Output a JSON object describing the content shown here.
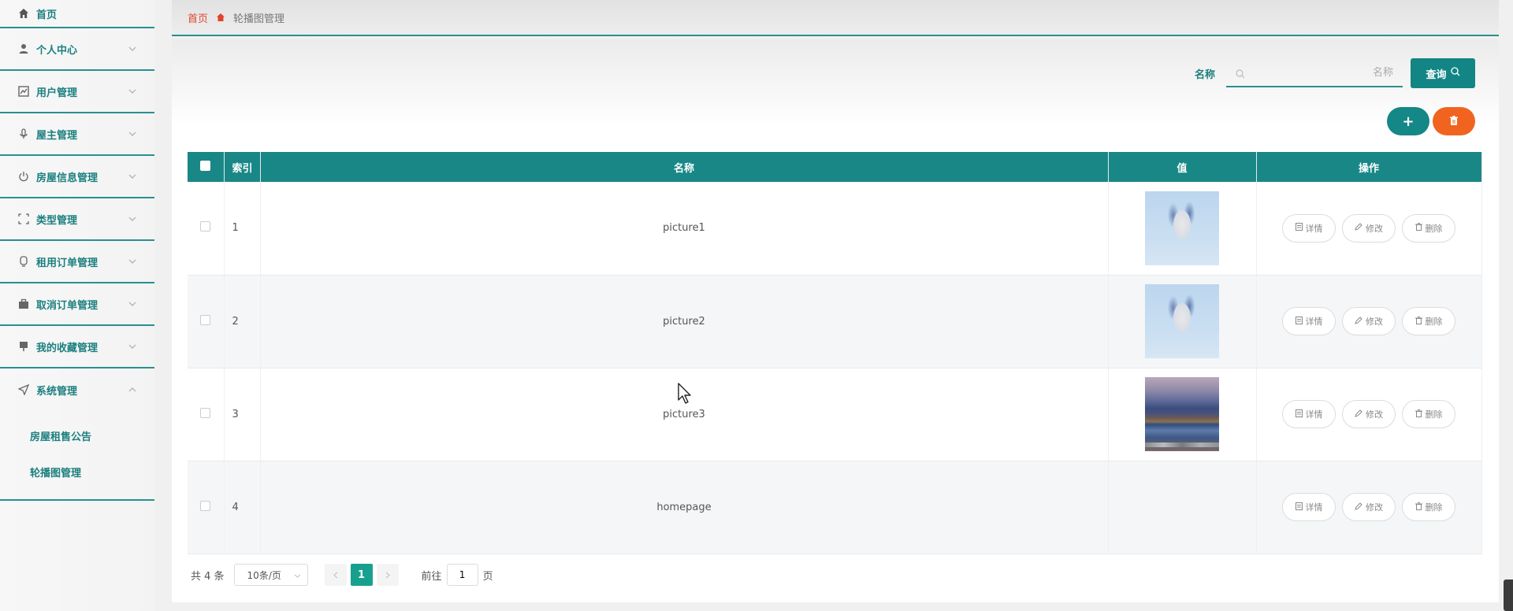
{
  "sidebar": {
    "home": {
      "label": "首页",
      "icon": "home-icon"
    },
    "items": [
      {
        "label": "个人中心",
        "icon": "user-icon"
      },
      {
        "label": "用户管理",
        "icon": "chart-icon"
      },
      {
        "label": "屋主管理",
        "icon": "mic-icon"
      },
      {
        "label": "房屋信息管理",
        "icon": "power-icon"
      },
      {
        "label": "类型管理",
        "icon": "fullscreen-icon"
      },
      {
        "label": "租用订单管理",
        "icon": "badge-icon"
      },
      {
        "label": "取消订单管理",
        "icon": "briefcase-icon"
      },
      {
        "label": "我的收藏管理",
        "icon": "pin-icon"
      },
      {
        "label": "系统管理",
        "icon": "send-icon"
      }
    ],
    "submenu": [
      {
        "label": "房屋租售公告"
      },
      {
        "label": "轮播图管理"
      }
    ]
  },
  "breadcrumb": {
    "home": "首页",
    "current": "轮播图管理"
  },
  "search": {
    "label": "名称",
    "placeholder": "名称",
    "value": "",
    "button": "查询"
  },
  "actions": {
    "add": "+",
    "delete": "delete-icon"
  },
  "table": {
    "headers": {
      "index": "索引",
      "name": "名称",
      "value": "值",
      "ops": "操作"
    },
    "rows": [
      {
        "index": "1",
        "name": "picture1",
        "image": "flower-image"
      },
      {
        "index": "2",
        "name": "picture2",
        "image": "flower-image"
      },
      {
        "index": "3",
        "name": "picture3",
        "image": "lake-image"
      },
      {
        "index": "4",
        "name": "homepage",
        "image": "broken-image"
      }
    ],
    "ops": {
      "detail": "详情",
      "edit": "修改",
      "delete": "删除"
    }
  },
  "pagination": {
    "total": "共 4 条",
    "page_size": "10条/页",
    "current": "1",
    "goto_label": "前往",
    "goto_value": "1",
    "page_suffix": "页"
  },
  "colors": {
    "accent": "#1a8787",
    "danger": "#f06420",
    "breadcrumb_home": "#e0452a"
  }
}
